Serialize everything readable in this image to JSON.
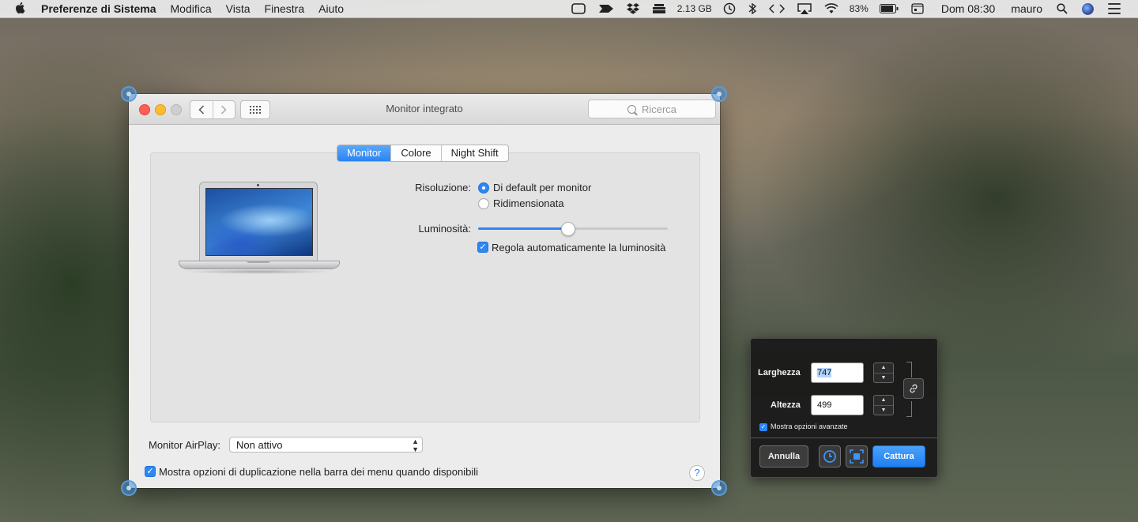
{
  "menubar": {
    "app_name": "Preferenze di Sistema",
    "items": [
      "Modifica",
      "Vista",
      "Finestra",
      "Aiuto"
    ],
    "status": {
      "memory": "2.13 GB",
      "battery": "83%",
      "clock": "Dom 08:30",
      "user": "mauro"
    },
    "icons": [
      "apple-icon",
      "display-icon",
      "messages-icon",
      "dropbox-icon",
      "stack-icon",
      "time-machine-icon",
      "bluetooth-icon",
      "code-icon",
      "airplay-icon",
      "wifi-icon",
      "battery-icon",
      "calendar-icon",
      "spotlight-icon",
      "siri-icon",
      "notification-center-icon"
    ]
  },
  "window": {
    "title": "Monitor integrato",
    "search_placeholder": "Ricerca",
    "tabs": [
      "Monitor",
      "Colore",
      "Night Shift"
    ],
    "active_tab": "Monitor",
    "resolution_label": "Risoluzione:",
    "resolution_options": [
      "Di default per monitor",
      "Ridimensionata"
    ],
    "resolution_selected": "Di default per monitor",
    "brightness_label": "Luminosità:",
    "brightness_value": 0.47,
    "auto_brightness_label": "Regola automaticamente la luminosità",
    "auto_brightness_checked": true,
    "airplay_label": "Monitor AirPlay:",
    "airplay_value": "Non attivo",
    "mirroring_label": "Mostra opzioni di duplicazione nella barra dei menu quando disponibili",
    "mirroring_checked": true,
    "help_label": "?"
  },
  "capture_hud": {
    "width_label": "Larghezza",
    "width_value": "747",
    "height_label": "Altezza",
    "height_value": "499",
    "advanced_label": "Mostra opzioni avanzate",
    "advanced_checked": true,
    "cancel_label": "Annulla",
    "capture_label": "Cattura"
  },
  "colors": {
    "accent": "#2d87f5",
    "close": "#fc5f57",
    "minimize": "#fdbb2e"
  }
}
